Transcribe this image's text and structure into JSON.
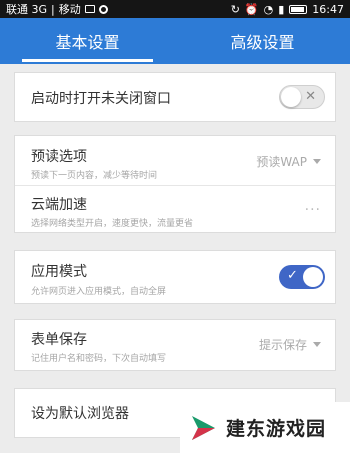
{
  "status_bar": {
    "carrier": "联通 3G",
    "carrier2": "移动",
    "time": "16:47",
    "icons": [
      "image-icon",
      "circle-icon",
      "refresh-icon",
      "alarm-icon",
      "wifi-icon",
      "signal-icon",
      "battery-icon"
    ]
  },
  "tabs": [
    {
      "label": "基本设置",
      "active": true
    },
    {
      "label": "高级设置",
      "active": false
    }
  ],
  "settings": {
    "restore_windows": {
      "title": "启动时打开未关闭窗口",
      "toggle": "off"
    },
    "preload": {
      "title": "预读选项",
      "subtitle": "预读下一页内容，减少等待时间",
      "value": "预读WAP"
    },
    "cloud_accel": {
      "title": "云端加速",
      "subtitle": "选择网络类型开启，速度更快，流量更省",
      "value": "..."
    },
    "app_mode": {
      "title": "应用模式",
      "subtitle": "允许网页进入应用模式，自动全屏",
      "toggle": "on"
    },
    "form_save": {
      "title": "表单保存",
      "subtitle": "记住用户名和密码，下次自动填写",
      "value": "提示保存"
    },
    "default_browser": {
      "title": "设为默认浏览器"
    }
  },
  "watermark": {
    "text": "建东游戏园"
  },
  "colors": {
    "accent": "#2d7bd6",
    "toggle_on": "#3f66c6"
  }
}
